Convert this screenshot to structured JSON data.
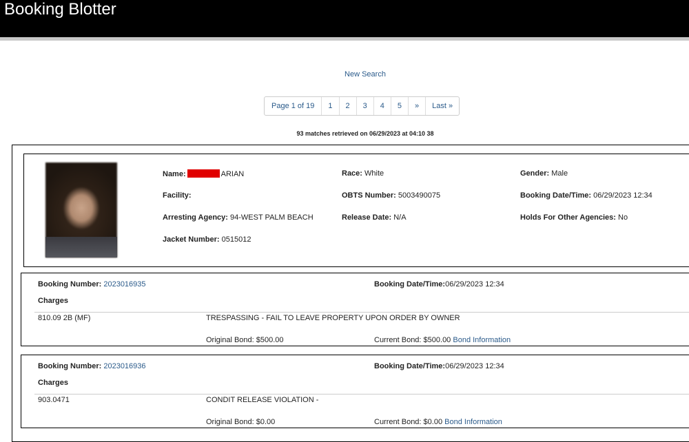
{
  "header": {
    "title": "Booking Blotter"
  },
  "nav": {
    "new_search": "New Search"
  },
  "pagination": {
    "page_label": "Page 1 of 19",
    "pages": [
      "1",
      "2",
      "3",
      "4",
      "5"
    ],
    "next": "»",
    "last": "Last »"
  },
  "results": {
    "summary": "93 matches retrieved on 06/29/2023 at 04:10 38"
  },
  "inmate": {
    "name_label": "Name:",
    "name_visible": "ARIAN",
    "race_label": "Race:",
    "race": "White",
    "gender_label": "Gender:",
    "gender": "Male",
    "facility_label": "Facility:",
    "facility": "",
    "obts_label": "OBTS Number:",
    "obts": "5003490075",
    "booking_dt_label": "Booking Date/Time:",
    "booking_dt": "06/29/2023 12:34",
    "agency_label": "Arresting Agency:",
    "agency": "94-WEST PALM BEACH",
    "release_label": "Release Date:",
    "release": "N/A",
    "holds_label": "Holds For Other Agencies:",
    "holds": "No",
    "jacket_label": "Jacket Number:",
    "jacket": "0515012"
  },
  "bookings": [
    {
      "number_label": "Booking Number:",
      "number": "2023016935",
      "dt_label": "Booking Date/Time:",
      "dt": "06/29/2023 12:34",
      "charges_label": "Charges",
      "statute": "810.09 2B (MF)",
      "description": "TRESPASSING - FAIL TO LEAVE PROPERTY UPON ORDER BY OWNER",
      "original_bond": "Original Bond: $500.00",
      "current_bond": "Current Bond: $500.00",
      "bond_link": "Bond Information"
    },
    {
      "number_label": "Booking Number:",
      "number": "2023016936",
      "dt_label": "Booking Date/Time:",
      "dt": "06/29/2023 12:34",
      "charges_label": "Charges",
      "statute": "903.0471",
      "description": "CONDIT RELEASE VIOLATION -",
      "original_bond": "Original Bond: $0.00",
      "current_bond": "Current Bond: $0.00",
      "bond_link": "Bond Information"
    }
  ]
}
